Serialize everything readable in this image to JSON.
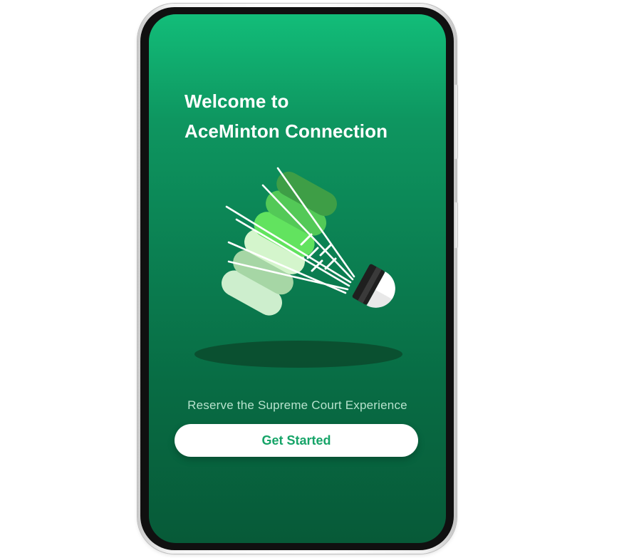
{
  "welcome": {
    "title_line1": "Welcome to",
    "title_line2": "AceMinton Connection",
    "tagline": "Reserve the Supreme Court Experience",
    "cta_label": "Get Started"
  },
  "illustration": {
    "name": "shuttlecock-icon"
  },
  "colors": {
    "screen_top": "#12bd79",
    "screen_bottom": "#075a38",
    "button_background": "#ffffff",
    "button_text": "#16a468",
    "tagline_text": "#b7e2cd",
    "shadow": "#0a4a2d"
  }
}
